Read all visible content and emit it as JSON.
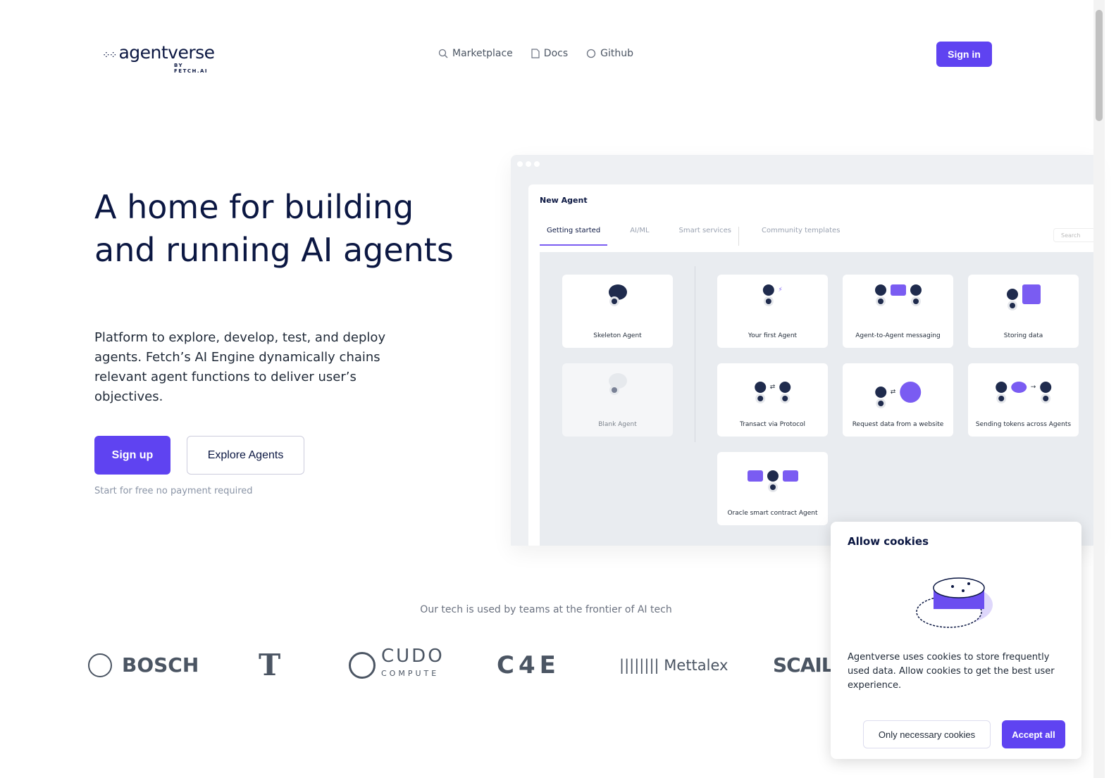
{
  "header": {
    "logo_text": "agentverse",
    "logo_sub": "BY FETCH.AI",
    "nav": [
      {
        "label": "Marketplace",
        "icon": "search-icon"
      },
      {
        "label": "Docs",
        "icon": "document-icon"
      },
      {
        "label": "Github",
        "icon": "github-icon"
      }
    ],
    "signin": "Sign in"
  },
  "hero": {
    "title": "A home for building and running AI agents",
    "subtitle": "Platform to explore, develop, test, and deploy agents. Fetch’s AI Engine dynamically chains relevant agent functions to deliver user’s objectives.",
    "signup": "Sign up",
    "explore": "Explore Agents",
    "note": "Start for free no payment required"
  },
  "mock": {
    "title": "New Agent",
    "tabs": [
      "Getting started",
      "AI/ML",
      "Smart services",
      "Community templates"
    ],
    "search_placeholder": "Search",
    "left_cards": [
      "Skeleton Agent",
      "Blank Agent"
    ],
    "cards": [
      "Your first Agent",
      "Agent-to-Agent messaging",
      "Storing data",
      "Transact via Protocol",
      "Request data from a website",
      "Sending tokens across Agents",
      "Oracle smart contract Agent"
    ]
  },
  "trust": {
    "text": "Our tech is used by teams at the frontier of AI tech",
    "logos": [
      "BOSCH",
      "T",
      "CUDO COMPUTE",
      "C4E",
      "Mettalex",
      "SCAIL"
    ]
  },
  "cookie": {
    "title": "Allow cookies",
    "body": "Agentverse uses cookies to store frequently used data. Allow cookies to get the best user experience.",
    "necessary": "Only necessary cookies",
    "accept": "Accept all"
  },
  "colors": {
    "accent": "#5f43f1",
    "text": "#0b1742"
  }
}
